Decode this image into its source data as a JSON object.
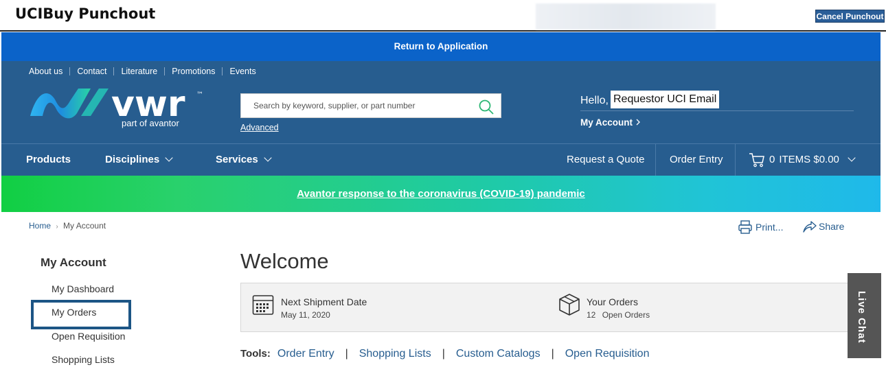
{
  "topbar": {
    "title": "UCIBuy Punchout",
    "cancel_label": "Cancel Punchout"
  },
  "return_bar": {
    "label": "Return to Application"
  },
  "utility_links": [
    "About us",
    "Contact",
    "Literature",
    "Promotions",
    "Events"
  ],
  "logo": {
    "wordmark": "vwr",
    "trademark": "™",
    "tagline": "part of avantor"
  },
  "search": {
    "placeholder": "Search by keyword, supplier, or part number",
    "advanced_label": "Advanced"
  },
  "account": {
    "greeting": "Hello,",
    "user_name": "Requestor UCI Email",
    "my_account_label": "My Account"
  },
  "nav": {
    "products": "Products",
    "disciplines": "Disciplines",
    "services": "Services",
    "request_quote": "Request a Quote",
    "order_entry": "Order Entry",
    "cart_count": "0",
    "cart_text": "ITEMS $0.00"
  },
  "banner": {
    "text": "Avantor response to the coronavirus (COVID-19) pandemic"
  },
  "breadcrumb": {
    "home": "Home",
    "separator": "›",
    "current": "My Account"
  },
  "actions": {
    "print": "Print...",
    "share": "Share"
  },
  "sidebar": {
    "title": "My Account",
    "items": [
      "My Dashboard",
      "My Orders",
      "Open Requisition",
      "Shopping Lists"
    ]
  },
  "main": {
    "heading": "Welcome",
    "shipment_label": "Next Shipment Date",
    "shipment_date": "May 11, 2020",
    "orders_label": "Your Orders",
    "orders_count": "12",
    "orders_text": "Open Orders"
  },
  "tools": {
    "label": "Tools:",
    "links": [
      "Order Entry",
      "Shopping Lists",
      "Custom Catalogs",
      "Open Requisition"
    ],
    "separator": "|"
  },
  "live_chat": {
    "label": "Live Chat"
  },
  "colors": {
    "header_blue": "#275d8f",
    "return_blue": "#0b63c9",
    "link_blue": "#275d8f",
    "search_green": "#2bb673"
  }
}
